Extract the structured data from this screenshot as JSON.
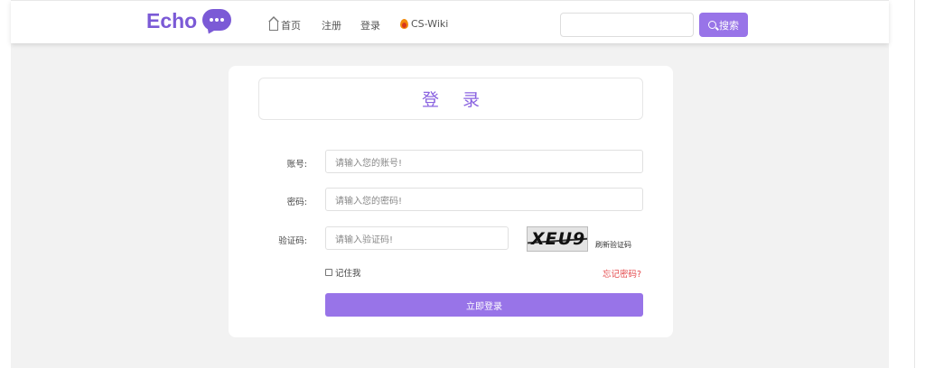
{
  "header": {
    "logo_text": "Echo",
    "nav": {
      "home": "首页",
      "register": "注册",
      "login": "登录",
      "wiki": "CS-Wiki"
    },
    "search": {
      "placeholder": "",
      "button_label": "搜索"
    }
  },
  "login_form": {
    "title": "登 录",
    "account_label": "账号:",
    "account_placeholder": "请输入您的账号!",
    "password_label": "密码:",
    "password_placeholder": "请输入您的密码!",
    "captcha_label": "验证码:",
    "captcha_placeholder": "请输入验证码!",
    "captcha_text": "XEU9",
    "refresh_captcha": "刷新验证码",
    "remember_me": "记住我",
    "forgot_password": "忘记密码?",
    "submit_label": "立即登录"
  },
  "colors": {
    "brand": "#7b5ad6",
    "button": "#9874e8",
    "link_warning": "#e4474a",
    "background": "#f2f2f2"
  },
  "icons": {
    "home": "home-icon",
    "wiki": "fire-icon",
    "search": "search-icon",
    "logo": "chat-bubble-icon"
  }
}
